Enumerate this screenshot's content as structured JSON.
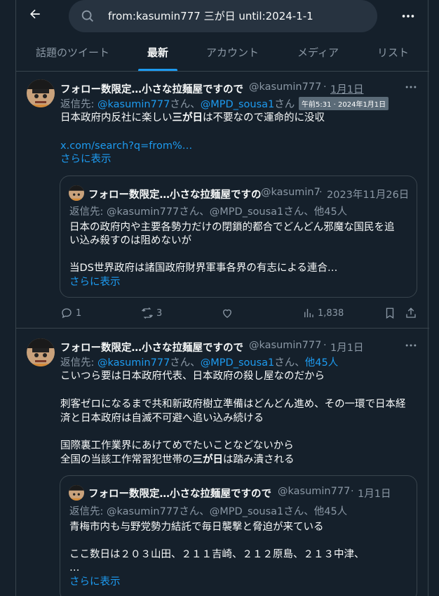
{
  "search": {
    "query": "from:kasumin777 三が日 until:2024-1-1"
  },
  "tabs": [
    "話題のツイート",
    "最新",
    "アカウント",
    "メディア",
    "リスト"
  ],
  "tweet1": {
    "display_name": "フォロー数限定…小さな拉麺屋ですので",
    "handle": "@kasumin777",
    "sep": "·",
    "date": "1月1日",
    "tooltip": "午前5:31 · 2024年1月1日",
    "reply_prefix": "返信先: ",
    "reply_user1": "@kasumin777",
    "reply_mid": "さん、",
    "reply_user2": "@MPD_sousa1",
    "reply_suffix": "さん",
    "text_a": "日本政府内反社に楽しい",
    "text_bold": "三が日",
    "text_b": "は不要なので運命的に没収",
    "link": "x.com/search?q=from%…",
    "show_more": "さらに表示",
    "quote": {
      "display_name": "フォロー数限定…小さな拉麺屋ですの",
      "handle": "@kasumin7",
      "sep": "·",
      "date": "2023年11月26日",
      "reply": "返信先: @kasumin777さん、@MPD_sousa1さん、他45人",
      "line1": "日本の政府内や主要各勢力だけの閉鎖的都合でどんどん邪魔な国民を追",
      "line2": "い込み殺すのは阻めないが",
      "line3": "当DS世界政府は諸国政府財界軍事各界の有志による連合…",
      "show_more": "さらに表示"
    },
    "actions": {
      "replies": "1",
      "retweets": "3",
      "views": "1,838"
    }
  },
  "tweet2": {
    "display_name": "フォロー数限定…小さな拉麺屋ですので",
    "handle": "@kasumin777",
    "sep": "·",
    "date": "1月1日",
    "reply_prefix": "返信先: ",
    "reply_user1": "@kasumin777",
    "reply_mid": "さん、",
    "reply_user2": "@MPD_sousa1",
    "reply_mid2": "さん、",
    "reply_others": "他45人",
    "line1": "こいつら要は日本政府代表、日本政府の殺し屋なのだから",
    "line2": "刺客ゼロになるまで共和新政府樹立準備はどんどん進め、その一環で日本経",
    "line3": "済と日本政府は自滅不可避へ追い込み続ける",
    "line4": "国際裏工作業界にあけてめでたいことなどないから",
    "line5a": "全国の当該工作常習犯世帯の",
    "line5bold": "三が日",
    "line5b": "は踏み潰される",
    "quote": {
      "display_name": "フォロー数限定…小さな拉麺屋ですので",
      "handle": "@kasumin777",
      "sep": "·",
      "date": "1月1日",
      "reply": "返信先: @kasumin777さん、@MPD_sousa1さん、他45人",
      "line1": "青梅市内も与野党勢力結託で毎日襲撃と脅迫が来ている",
      "line2": "ここ数日は２０３山田、２１１吉崎、２１２原島、２１３中津、",
      "line3": "…",
      "show_more": "さらに表示"
    }
  }
}
